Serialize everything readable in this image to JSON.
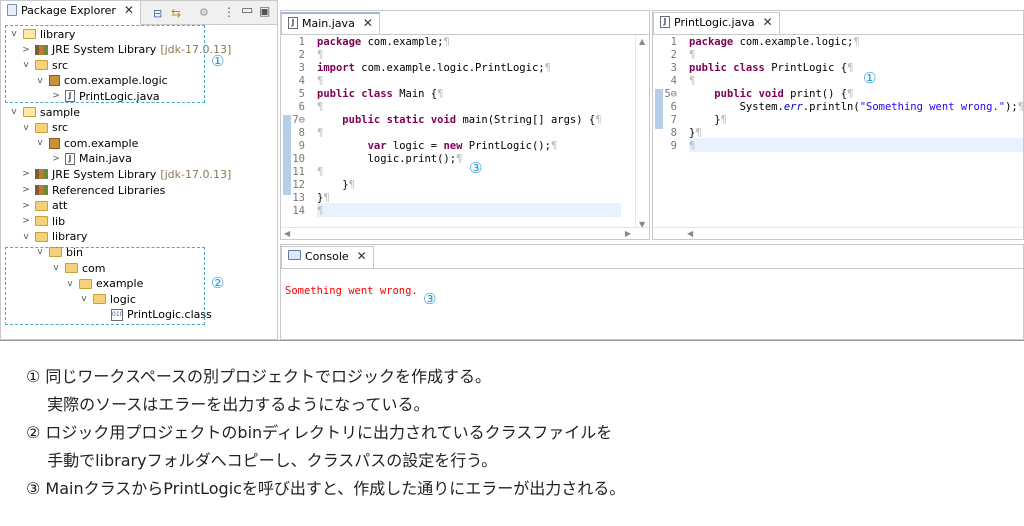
{
  "explorer": {
    "title": "Package Explorer",
    "tree": [
      {
        "label": "library",
        "kind": "project",
        "arrow": "v"
      },
      {
        "label": "JRE System Library",
        "suffix": "[jdk-17.0.13]",
        "kind": "lib",
        "arrow": ">"
      },
      {
        "label": "src",
        "kind": "folder",
        "arrow": "v"
      },
      {
        "label": "com.example.logic",
        "kind": "pkg",
        "arrow": "v"
      },
      {
        "label": "PrintLogic.java",
        "kind": "java",
        "arrow": ">"
      },
      {
        "label": "sample",
        "kind": "project",
        "arrow": "v"
      },
      {
        "label": "src",
        "kind": "folder",
        "arrow": "v"
      },
      {
        "label": "com.example",
        "kind": "pkg",
        "arrow": "v"
      },
      {
        "label": "Main.java",
        "kind": "java",
        "arrow": ">"
      },
      {
        "label": "JRE System Library",
        "suffix": "[jdk-17.0.13]",
        "kind": "lib",
        "arrow": ">"
      },
      {
        "label": "Referenced Libraries",
        "kind": "lib",
        "arrow": ">"
      },
      {
        "label": "att",
        "kind": "folder",
        "arrow": ">"
      },
      {
        "label": "lib",
        "kind": "folder",
        "arrow": ">"
      },
      {
        "label": "library",
        "kind": "folder",
        "arrow": "v"
      },
      {
        "label": "bin",
        "kind": "folder",
        "arrow": "v"
      },
      {
        "label": "com",
        "kind": "folder",
        "arrow": "v"
      },
      {
        "label": "example",
        "kind": "folder",
        "arrow": "v"
      },
      {
        "label": "logic",
        "kind": "folder",
        "arrow": "v"
      },
      {
        "label": "PrintLogic.class",
        "kind": "class",
        "arrow": ""
      }
    ]
  },
  "main_editor": {
    "tab": "Main.java",
    "lines": [
      [
        [
          "kw",
          "package"
        ],
        [
          "t",
          " com.example;"
        ]
      ],
      [],
      [
        [
          "kw",
          "import"
        ],
        [
          "t",
          " com.example.logic.PrintLogic;"
        ]
      ],
      [],
      [
        [
          "kw",
          "public"
        ],
        [
          "t",
          " "
        ],
        [
          "kw",
          "class"
        ],
        [
          "t",
          " Main {"
        ]
      ],
      [],
      [
        [
          "t",
          "    "
        ],
        [
          "kw",
          "public"
        ],
        [
          "t",
          " "
        ],
        [
          "kw",
          "static"
        ],
        [
          "t",
          " "
        ],
        [
          "kw",
          "void"
        ],
        [
          "t",
          " main(String[] args) {"
        ]
      ],
      [],
      [
        [
          "t",
          "        "
        ],
        [
          "kw",
          "var"
        ],
        [
          "t",
          " logic = "
        ],
        [
          "kw",
          "new"
        ],
        [
          "t",
          " PrintLogic();"
        ]
      ],
      [
        [
          "t",
          "        logic.print();"
        ]
      ],
      [],
      [
        [
          "t",
          "    }"
        ]
      ],
      [
        [
          "t",
          "}"
        ]
      ],
      []
    ]
  },
  "logic_editor": {
    "tab": "PrintLogic.java",
    "lines": [
      [
        [
          "kw",
          "package"
        ],
        [
          "t",
          " com.example.logic;"
        ]
      ],
      [],
      [
        [
          "kw",
          "public"
        ],
        [
          "t",
          " "
        ],
        [
          "kw",
          "class"
        ],
        [
          "t",
          " PrintLogic {"
        ]
      ],
      [],
      [
        [
          "t",
          "    "
        ],
        [
          "kw",
          "public"
        ],
        [
          "t",
          " "
        ],
        [
          "kw",
          "void"
        ],
        [
          "t",
          " print() {"
        ]
      ],
      [
        [
          "t",
          "        System."
        ],
        [
          "field",
          "err"
        ],
        [
          "t",
          ".println("
        ],
        [
          "str",
          "\"Something went wrong.\""
        ],
        [
          "t",
          ");"
        ]
      ],
      [
        [
          "t",
          "    }"
        ]
      ],
      [
        [
          "t",
          "}"
        ]
      ],
      []
    ]
  },
  "console": {
    "tab": "Console",
    "output": "Something went wrong.",
    "output_color": "#ff0000"
  },
  "markers": {
    "one": "①",
    "two": "②",
    "three": "③"
  },
  "notes": [
    "① 同じワークスペースの別プロジェクトでロジックを作成する。",
    "　 実際のソースはエラーを出力するようになっている。",
    "② ロジック用プロジェクトのbinディレクトリに出力されているクラスファイルを",
    "　 手動でlibraryフォルダへコピーし、クラスパスの設定を行う。",
    "③ MainクラスからPrintLogicを呼び出すと、作成した通りにエラーが出力される。"
  ],
  "colors": {
    "keyword": "#7f0055",
    "string": "#2a00ff",
    "marker": "#2a9fd0",
    "highlight_line": "#e8f2fe"
  }
}
